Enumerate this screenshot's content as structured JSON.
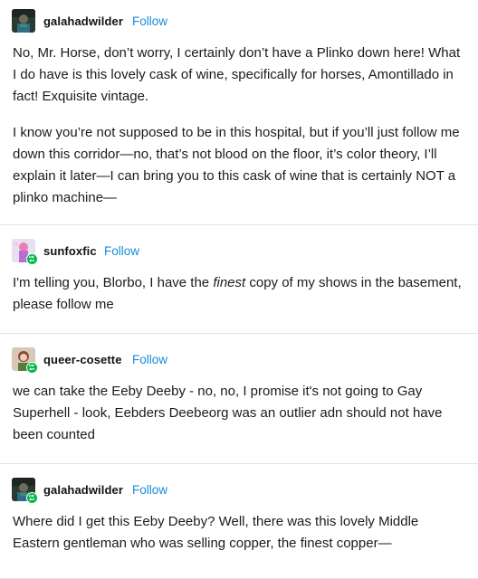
{
  "posts": [
    {
      "username": "galahadwilder",
      "follow_label": "Follow",
      "paragraphs": [
        "No, Mr. Horse, don’t worry, I certainly don’t have a Plinko down here! What I do have is this lovely cask of wine, specifically for horses, Amontillado in fact! Exquisite vintage.",
        "I know you’re not supposed to be in this hospital, but if you’ll just follow me down this corridor—no, that’s not blood on the floor, it’s color theory, I’ll explain it later—I can bring you to this cask of wine that is certainly NOT a plinko machine—"
      ]
    },
    {
      "username": "sunfoxfic",
      "follow_label": "Follow",
      "text_before": "I'm telling you, Blorbo, I have the ",
      "text_emphasis": "finest",
      "text_after": " copy of my shows in the basement, please follow me"
    },
    {
      "username": "queer-cosette",
      "follow_label": "Follow",
      "paragraphs": [
        "we can take the Eeby Deeby - no, no, I promise it's not going to Gay Superhell - look, Eebders Deebeorg was an outlier adn should not have been counted"
      ]
    },
    {
      "username": "galahadwilder",
      "follow_label": "Follow",
      "paragraphs": [
        "Where did I get this Eeby Deeby? Well, there was this lovely Middle Eastern gentleman who was selling copper, the finest copper—"
      ]
    }
  ],
  "colors": {
    "follow": "#1a8cd8",
    "reblog_badge": "#00b84a",
    "divider": "#e3e3e3"
  },
  "icons": {
    "reblog_badge": "reblog-icon"
  }
}
